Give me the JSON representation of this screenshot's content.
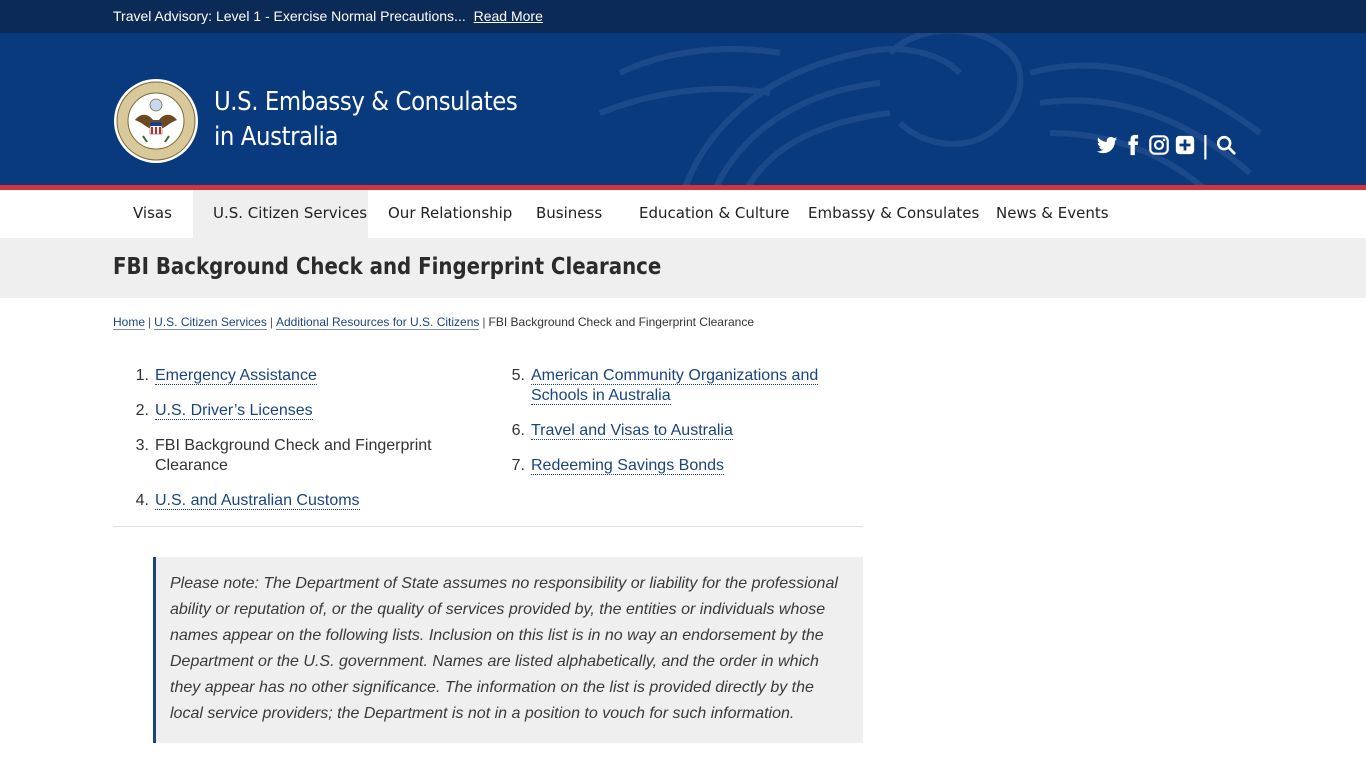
{
  "advisory": {
    "text": "Travel Advisory: Level 1 - Exercise Normal Precautions...",
    "link": "Read More"
  },
  "header": {
    "title_line1": "U.S. Embassy & Consulates",
    "title_line2": "in Australia",
    "seal_icon": "department-of-state-seal",
    "social_icons": [
      "twitter-icon",
      "facebook-icon",
      "instagram-icon",
      "plus-share-icon",
      "search-icon"
    ]
  },
  "nav": {
    "items": [
      {
        "label": "Visas"
      },
      {
        "label": "U.S. Citizen Services"
      },
      {
        "label": "Our Relationship"
      },
      {
        "label": "Business"
      },
      {
        "label": "Education & Culture"
      },
      {
        "label": "Embassy & Consulates"
      },
      {
        "label": "News & Events"
      }
    ]
  },
  "page": {
    "title": "FBI Background Check and Fingerprint Clearance"
  },
  "breadcrumb": {
    "items": [
      "Home",
      "U.S. Citizen Services",
      "Additional Resources for U.S. Citizens"
    ],
    "current": "FBI Background Check and Fingerprint Clearance",
    "separator": "|"
  },
  "list": {
    "items": [
      {
        "num": "1.",
        "label": "Emergency Assistance"
      },
      {
        "num": "2.",
        "label": "U.S. Driver’s Licenses"
      },
      {
        "num": "3.",
        "label": "FBI Background Check and Fingerprint Clearance"
      },
      {
        "num": "4.",
        "label": "U.S. and Australian Customs"
      },
      {
        "num": "5.",
        "label": "American Community Organizations and Schools in Australia"
      },
      {
        "num": "6.",
        "label": "Travel and Visas to Australia"
      },
      {
        "num": "7.",
        "label": "Redeeming Savings Bonds"
      }
    ]
  },
  "note": {
    "text": "Please note: The Department of State assumes no responsibility or liability for the professional ability or reputation of, or the quality of services provided by, the entities or individuals whose names appear on the following lists. Inclusion on this list is in no way an endorsement by the Department or the U.S. government. Names are listed alphabetically, and the order in which they appear has no other significance. The information on the list is provided directly by the local service providers; the Department is not in a position to vouch for such information."
  },
  "colors": {
    "header_blue": "#0a3a7e",
    "advisory_navy": "#0b2a55",
    "accent_red": "#d2343f",
    "link_blue": "#1a4480"
  }
}
